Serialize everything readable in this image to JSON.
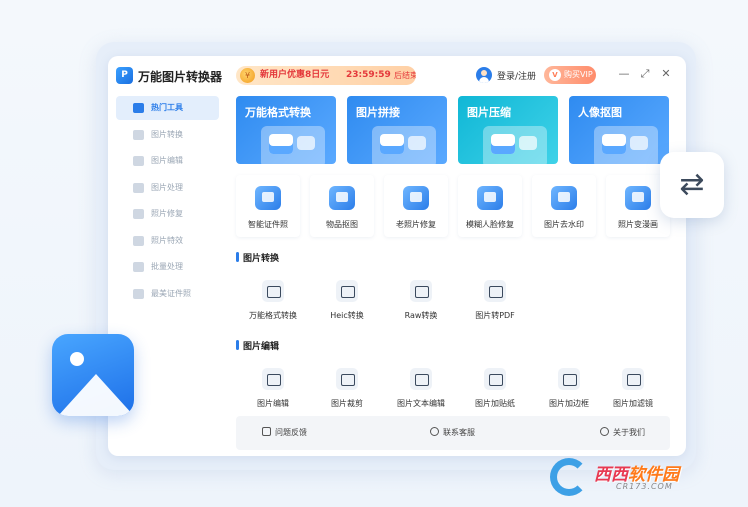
{
  "app": {
    "title": "万能图片转换器",
    "logo_text": "P"
  },
  "promo": {
    "text": "新用户优惠8日元",
    "timer": "23:59:59",
    "ends": "后结束"
  },
  "user": {
    "login_label": "登录/注册"
  },
  "vip": {
    "label": "购买VIP",
    "icon_text": "V"
  },
  "window_controls": {
    "minimize": "—",
    "maximize": "⤢",
    "close": "✕"
  },
  "sidebar": {
    "items": [
      {
        "label": "热门工具"
      },
      {
        "label": "图片转换"
      },
      {
        "label": "图片编辑"
      },
      {
        "label": "图片处理"
      },
      {
        "label": "照片修复"
      },
      {
        "label": "照片特效"
      },
      {
        "label": "批量处理"
      },
      {
        "label": "最美证件照"
      }
    ]
  },
  "features": [
    {
      "label": "万能格式转换",
      "color_from": "#2f8bf0",
      "color_to": "#5aa9ff"
    },
    {
      "label": "图片拼接",
      "color_from": "#2f8bf0",
      "color_to": "#5aa9ff"
    },
    {
      "label": "图片压缩",
      "color_from": "#10b7d6",
      "color_to": "#3fd2e8"
    },
    {
      "label": "人像抠图",
      "color_from": "#2f8bf0",
      "color_to": "#5aa9ff"
    }
  ],
  "tools": [
    {
      "label": "智能证件照"
    },
    {
      "label": "物品抠图"
    },
    {
      "label": "老照片修复"
    },
    {
      "label": "模糊人脸修复"
    },
    {
      "label": "图片去水印"
    },
    {
      "label": "照片变漫画"
    }
  ],
  "section_convert": {
    "title": "图片转换",
    "items": [
      {
        "label": "万能格式转换"
      },
      {
        "label": "Heic转换"
      },
      {
        "label": "Raw转换"
      },
      {
        "label": "图片转PDF"
      }
    ]
  },
  "section_edit": {
    "title": "图片编辑",
    "items": [
      {
        "label": "图片编辑"
      },
      {
        "label": "图片裁剪"
      },
      {
        "label": "图片文本编辑"
      },
      {
        "label": "图片加贴纸"
      },
      {
        "label": "图片加边框"
      },
      {
        "label": "图片加滤镜"
      }
    ]
  },
  "footer": {
    "feedback": "问题反馈",
    "support": "联系客服",
    "about": "关于我们"
  },
  "watermark": {
    "brand_a": "西西",
    "brand_b": "软件园",
    "domain": "CR173.COM"
  }
}
